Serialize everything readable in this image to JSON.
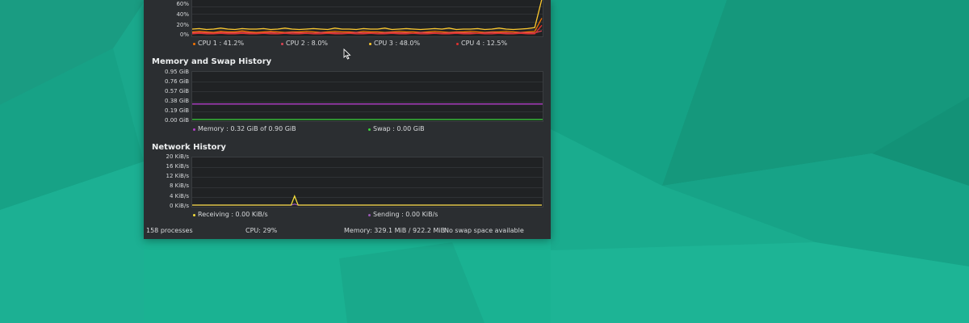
{
  "colors": {
    "desktop": "#1aa88c",
    "window_bg": "#2b2e31",
    "plot_bg": "#202224",
    "cpu1": "#f67400",
    "cpu2": "#da4453",
    "cpu3": "#fdc92f",
    "cpu4": "#e0312f",
    "memory": "#b33ec9",
    "swap": "#3bd53b",
    "receiving": "#f2dc3a",
    "sending": "#9b59b6"
  },
  "cpu": {
    "y_ticks": [
      "60%",
      "40%",
      "20%",
      "0%"
    ],
    "legend": [
      "CPU 1 : 41.2%",
      "CPU 2 : 8.0%",
      "CPU 3 : 48.0%",
      "CPU 4 : 12.5%"
    ],
    "series": [
      {
        "color_key": "cpu1",
        "values": [
          6,
          7,
          6,
          5,
          7,
          6,
          6,
          8,
          6,
          5,
          6,
          7,
          6,
          5,
          6,
          6,
          7,
          6,
          5,
          6,
          7,
          6,
          6,
          5,
          7,
          6,
          6,
          5,
          6,
          7,
          6,
          6,
          5,
          6,
          7,
          6,
          5,
          6,
          6,
          7,
          6,
          5,
          6,
          6,
          7,
          6,
          5,
          6,
          7,
          35
        ]
      },
      {
        "color_key": "cpu2",
        "values": [
          4,
          5,
          4,
          3,
          5,
          4,
          4,
          5,
          4,
          3,
          4,
          5,
          3,
          4,
          5,
          4,
          4,
          3,
          5,
          4,
          4,
          3,
          4,
          5,
          4,
          4,
          3,
          4,
          5,
          4,
          4,
          3,
          5,
          4,
          4,
          3,
          4,
          5,
          4,
          4,
          3,
          4,
          5,
          4,
          4,
          3,
          5,
          4,
          4,
          8
        ]
      },
      {
        "color_key": "cpu3",
        "values": [
          12,
          13,
          11,
          12,
          14,
          12,
          11,
          13,
          12,
          12,
          13,
          11,
          12,
          14,
          12,
          11,
          12,
          13,
          12,
          11,
          14,
          12,
          12,
          11,
          13,
          12,
          12,
          14,
          11,
          12,
          13,
          12,
          11,
          12,
          13,
          12,
          14,
          11,
          12,
          12,
          13,
          11,
          12,
          14,
          12,
          11,
          12,
          13,
          15,
          75
        ]
      },
      {
        "color_key": "cpu4",
        "values": [
          2,
          3,
          2,
          2,
          3,
          2,
          2,
          3,
          2,
          2,
          3,
          2,
          2,
          3,
          2,
          2,
          3,
          2,
          2,
          3,
          2,
          2,
          3,
          2,
          2,
          3,
          2,
          2,
          3,
          2,
          2,
          3,
          2,
          2,
          3,
          2,
          2,
          3,
          2,
          2,
          3,
          2,
          2,
          3,
          2,
          2,
          3,
          2,
          2,
          20
        ]
      }
    ]
  },
  "memory": {
    "title": "Memory and Swap History",
    "y_ticks": [
      "0.95 GiB",
      "0.76 GiB",
      "0.57 GiB",
      "0.38 GiB",
      "0.19 GiB",
      "0.00 GiB"
    ],
    "legend": [
      "Memory : 0.32 GiB of 0.90 GiB",
      "Swap : 0.00 GiB"
    ],
    "memory_gib": 0.32,
    "swap_gib": 0.0
  },
  "network": {
    "title": "Network History",
    "y_ticks": [
      "20 KiB/s",
      "16 KiB/s",
      "12 KiB/s",
      "8 KiB/s",
      "4 KiB/s",
      "0 KiB/s"
    ],
    "legend": [
      "Receiving : 0.00 KiB/s",
      "Sending : 0.00 KiB/s"
    ],
    "receiving": [
      0,
      0,
      0,
      0,
      0,
      0,
      0,
      0,
      0,
      0,
      0,
      0,
      0,
      0,
      0,
      0,
      0,
      0,
      0,
      0,
      0,
      0,
      0,
      0,
      0,
      0,
      0,
      0,
      0,
      3.8,
      0,
      0,
      0,
      0,
      0,
      0,
      0,
      0,
      0,
      0,
      0,
      0,
      0,
      0,
      0,
      0,
      0,
      0,
      0,
      0,
      0,
      0,
      0,
      0,
      0,
      0,
      0,
      0,
      0,
      0,
      0,
      0,
      0,
      0,
      0,
      0,
      0,
      0,
      0,
      0,
      0,
      0,
      0,
      0,
      0,
      0,
      0,
      0,
      0,
      0,
      0,
      0,
      0,
      0,
      0,
      0,
      0,
      0,
      0,
      0,
      0,
      0,
      0,
      0,
      0,
      0,
      0,
      0,
      0,
      0
    ],
    "sending": [
      0,
      0,
      0,
      0,
      0,
      0,
      0,
      0,
      0,
      0,
      0,
      0,
      0,
      0,
      0,
      0,
      0,
      0,
      0,
      0,
      0,
      0,
      0,
      0,
      0,
      0,
      0,
      0,
      0,
      0.4,
      0,
      0,
      0,
      0,
      0,
      0,
      0,
      0,
      0,
      0,
      0,
      0,
      0,
      0,
      0,
      0,
      0,
      0,
      0,
      0,
      0,
      0,
      0,
      0,
      0,
      0,
      0,
      0,
      0,
      0,
      0,
      0,
      0,
      0,
      0,
      0,
      0,
      0,
      0,
      0,
      0,
      0,
      0,
      0,
      0,
      0,
      0,
      0,
      0,
      0,
      0,
      0,
      0,
      0,
      0,
      0,
      0,
      0,
      0,
      0,
      0,
      0,
      0,
      0,
      0,
      0,
      0,
      0,
      0,
      0
    ]
  },
  "statusbar": {
    "processes": "158 processes",
    "cpu": "CPU: 29%",
    "memory": "Memory: 329.1 MiB / 922.2 MiB",
    "swap": "No swap space available"
  }
}
